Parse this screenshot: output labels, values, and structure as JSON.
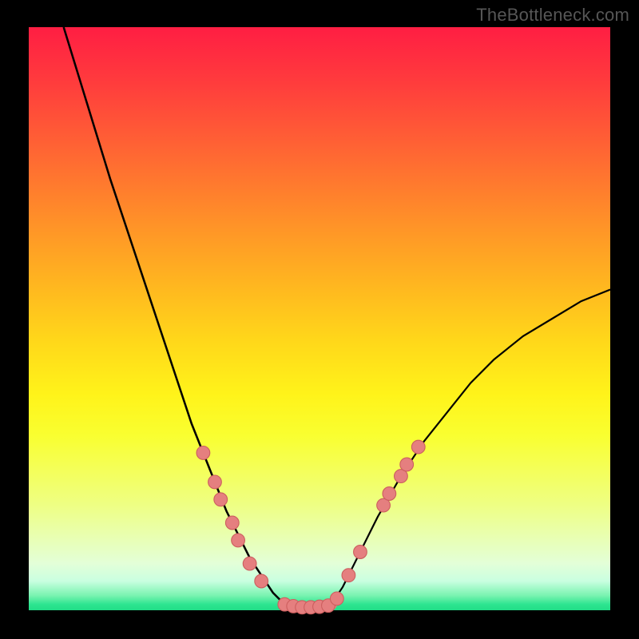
{
  "watermark": "TheBottleneck.com",
  "colors": {
    "background_black": "#000000",
    "gradient_top": "#ff1e43",
    "gradient_mid": "#ffe31a",
    "gradient_bottom": "#22dd87",
    "curve_stroke": "#000000",
    "marker_fill": "#e57f7f",
    "marker_stroke": "#cc5e5e"
  },
  "chart_data": {
    "type": "line",
    "title": "",
    "xlabel": "",
    "ylabel": "",
    "xlim": [
      0,
      100
    ],
    "ylim": [
      0,
      100
    ],
    "series": [
      {
        "name": "left-curve",
        "x": [
          6,
          10,
          14,
          18,
          22,
          26,
          28,
          30,
          32,
          34,
          36,
          38,
          40,
          42,
          44
        ],
        "y": [
          100,
          87,
          74,
          62,
          50,
          38,
          32,
          27,
          22,
          17,
          13,
          9,
          6,
          3,
          1
        ]
      },
      {
        "name": "right-curve",
        "x": [
          52,
          54,
          56,
          58,
          60,
          64,
          68,
          72,
          76,
          80,
          85,
          90,
          95,
          100
        ],
        "y": [
          1,
          4,
          8,
          12,
          16,
          23,
          29,
          34,
          39,
          43,
          47,
          50,
          53,
          55
        ]
      },
      {
        "name": "floor-segment",
        "x": [
          44,
          46,
          48,
          50,
          52
        ],
        "y": [
          1,
          0.6,
          0.5,
          0.6,
          1
        ]
      }
    ],
    "markers": {
      "name": "highlighted-points",
      "points": [
        {
          "x": 30,
          "y": 27
        },
        {
          "x": 32,
          "y": 22
        },
        {
          "x": 33,
          "y": 19
        },
        {
          "x": 35,
          "y": 15
        },
        {
          "x": 36,
          "y": 12
        },
        {
          "x": 38,
          "y": 8
        },
        {
          "x": 40,
          "y": 5
        },
        {
          "x": 44,
          "y": 1
        },
        {
          "x": 45.5,
          "y": 0.7
        },
        {
          "x": 47,
          "y": 0.5
        },
        {
          "x": 48.5,
          "y": 0.5
        },
        {
          "x": 50,
          "y": 0.6
        },
        {
          "x": 51.5,
          "y": 0.8
        },
        {
          "x": 53,
          "y": 2
        },
        {
          "x": 55,
          "y": 6
        },
        {
          "x": 57,
          "y": 10
        },
        {
          "x": 61,
          "y": 18
        },
        {
          "x": 62,
          "y": 20
        },
        {
          "x": 64,
          "y": 23
        },
        {
          "x": 65,
          "y": 25
        },
        {
          "x": 67,
          "y": 28
        }
      ]
    }
  }
}
